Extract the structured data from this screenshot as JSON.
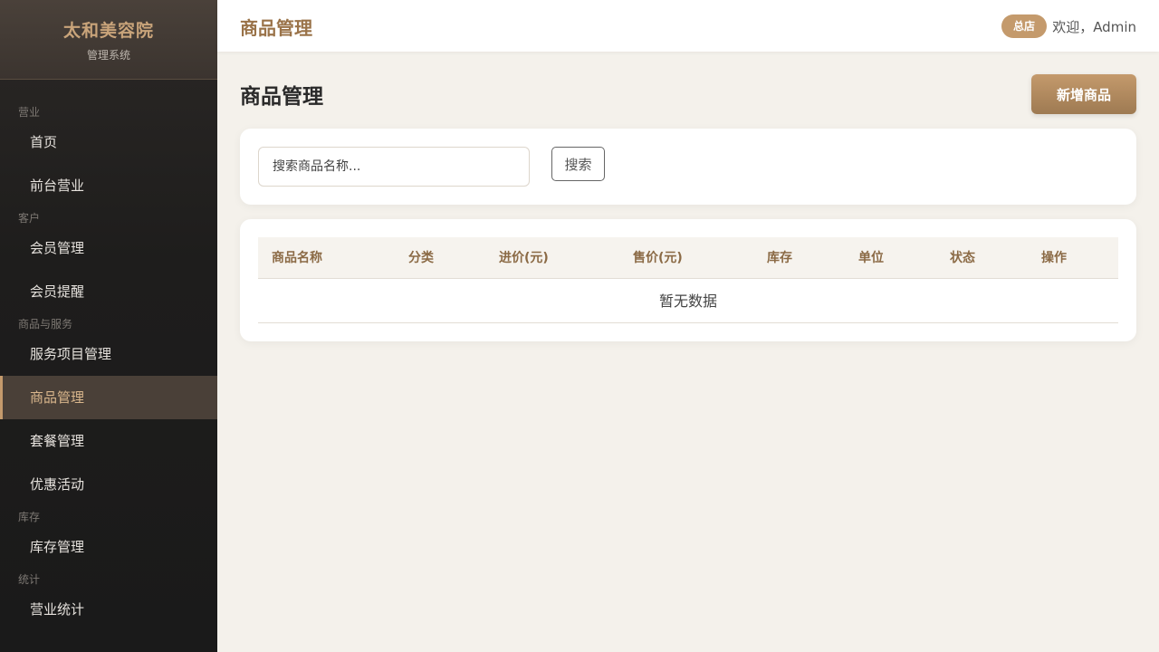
{
  "brand": {
    "title": "太和美容院",
    "subtitle": "管理系统"
  },
  "sidebar": {
    "groups": [
      {
        "label": "营业",
        "items": [
          "首页",
          "前台营业"
        ]
      },
      {
        "label": "客户",
        "items": [
          "会员管理",
          "会员提醒"
        ]
      },
      {
        "label": "商品与服务",
        "items": [
          "服务项目管理",
          "商品管理",
          "套餐管理",
          "优惠活动"
        ]
      },
      {
        "label": "库存",
        "items": [
          "库存管理"
        ]
      },
      {
        "label": "统计",
        "items": [
          "营业统计"
        ]
      }
    ],
    "active_item": "商品管理"
  },
  "header": {
    "title": "商品管理",
    "store_badge": "总店",
    "welcome": "欢迎，Admin"
  },
  "main": {
    "page_title": "商品管理",
    "add_button": "新增商品",
    "search": {
      "placeholder": "搜索商品名称...",
      "value": "",
      "button": "搜索"
    },
    "table": {
      "columns": [
        "商品名称",
        "分类",
        "进价(元)",
        "售价(元)",
        "库存",
        "单位",
        "状态",
        "操作"
      ],
      "rows": [],
      "empty_text": "暂无数据"
    }
  },
  "colors": {
    "accent": "#c49a6c",
    "accent_dark": "#9a7349",
    "sidebar_bg": "#1e1d1c",
    "page_bg": "#f4f1eb"
  }
}
